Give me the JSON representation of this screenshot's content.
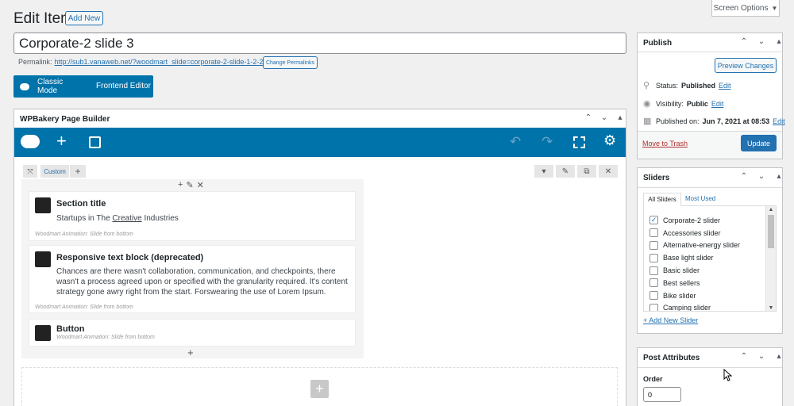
{
  "header": {
    "title": "Edit Item",
    "add_new": "Add New",
    "screen_options": "Screen Options"
  },
  "post": {
    "title_value": "Corporate-2 slide 3",
    "permalink_label": "Permalink:",
    "permalink_url": "http://sub1.vanaweb.net/?woodmart_slide=corporate-2-slide-1-2-2",
    "change_permalinks": "Change Permalinks"
  },
  "builder_buttons": {
    "classic_mode": "Classic Mode",
    "frontend_editor": "Frontend Editor"
  },
  "wpbakery": {
    "title": "WPBakery Page Builder",
    "row_custom_label": "Custom",
    "elements": [
      {
        "title": "Section title",
        "body": "Startups in The Creative Industries",
        "body_underlined": "Creative",
        "animation": "Woodmart Animation: Slide from bottom"
      },
      {
        "title": "Responsive text block (deprecated)",
        "body": "Chances are there wasn't collaboration, communication, and checkpoints, there wasn't a process agreed upon or specified with the granularity required. It's content strategy gone awry right from the start. Forswearing the use of Lorem Ipsum.",
        "animation": "Woodmart Animation: Slide from bottom"
      },
      {
        "title": "Button",
        "animation": "Woodmart Animation: Slide from bottom"
      }
    ]
  },
  "publish": {
    "title": "Publish",
    "preview_changes": "Preview Changes",
    "status_label": "Status:",
    "status_value": "Published",
    "visibility_label": "Visibility:",
    "visibility_value": "Public",
    "published_on_label": "Published on:",
    "published_on_value": "Jun 7, 2021 at 08:53",
    "edit": "Edit",
    "move_to_trash": "Move to Trash",
    "update": "Update"
  },
  "sliders": {
    "title": "Sliders",
    "tab_all": "All Sliders",
    "tab_most_used": "Most Used",
    "items": [
      {
        "label": "Corporate-2 slider",
        "checked": true
      },
      {
        "label": "Accessories slider",
        "checked": false
      },
      {
        "label": "Alternative-energy slider",
        "checked": false
      },
      {
        "label": "Base light slider",
        "checked": false
      },
      {
        "label": "Basic slider",
        "checked": false
      },
      {
        "label": "Best sellers",
        "checked": false
      },
      {
        "label": "Bike slider",
        "checked": false
      },
      {
        "label": "Camping slider",
        "checked": false
      }
    ],
    "add_new": "+ Add New Slider"
  },
  "post_attributes": {
    "title": "Post Attributes",
    "order_label": "Order",
    "order_value": "0"
  },
  "colors": {
    "wp_blue": "#2271b1",
    "wpb_blue": "#0073aa",
    "trash_red": "#b32d2e"
  }
}
